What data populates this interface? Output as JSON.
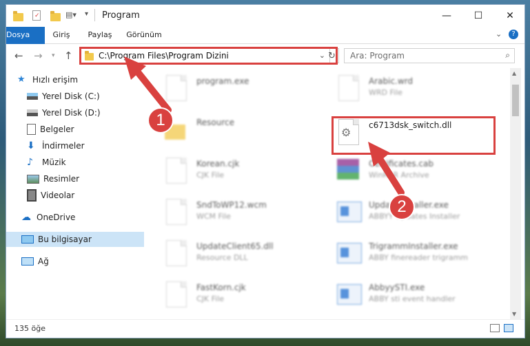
{
  "window": {
    "title": "Program"
  },
  "ribbon": {
    "tabs": [
      "Dosya",
      "Giriş",
      "Paylaş",
      "Görünüm"
    ]
  },
  "address": {
    "path": "C:\\Program Files\\Program Dizini"
  },
  "search": {
    "placeholder": "Ara: Program"
  },
  "sidebar": {
    "items": [
      {
        "label": "Hızlı erişim",
        "icon": "star-icon"
      },
      {
        "label": "Yerel Disk (C:)",
        "icon": "drive-icon",
        "pinned": true
      },
      {
        "label": "Yerel Disk (D:)",
        "icon": "drive-icon",
        "pinned": true
      },
      {
        "label": "Belgeler",
        "icon": "documents-icon",
        "pinned": true
      },
      {
        "label": "İndirmeler",
        "icon": "download-icon",
        "pinned": true
      },
      {
        "label": "Müzik",
        "icon": "music-icon",
        "pinned": true
      },
      {
        "label": "Resimler",
        "icon": "pictures-icon",
        "pinned": true
      },
      {
        "label": "Videolar",
        "icon": "video-icon",
        "pinned": true
      },
      {
        "label": "OneDrive",
        "icon": "cloud-icon"
      },
      {
        "label": "Bu bilgisayar",
        "icon": "computer-icon",
        "selected": true
      },
      {
        "label": "Ağ",
        "icon": "network-icon"
      }
    ]
  },
  "files": {
    "left": [
      {
        "name": "program.exe",
        "type": ""
      },
      {
        "name": "Resource",
        "type": ""
      },
      {
        "name": "Korean.cjk",
        "type": "CJK File"
      },
      {
        "name": "SndToWP12.wcm",
        "type": "WCM File"
      },
      {
        "name": "UpdateClient65.dll",
        "type": "Resource DLL"
      },
      {
        "name": "FastKorn.cjk",
        "type": "CJK File"
      }
    ],
    "right": [
      {
        "name": "Arabic.wrd",
        "type": "WRD File"
      },
      {
        "name": "c6713dsk_switch.dll",
        "type": ""
      },
      {
        "name": "Certificates.cab",
        "type": "WinRAR Archive"
      },
      {
        "name": "UpdateInstaller.exe",
        "type": "ABBYY Updates Installer"
      },
      {
        "name": "TrigrammInstaller.exe",
        "type": "ABBY finereader trigramm"
      },
      {
        "name": "AbbyySTI.exe",
        "type": "ABBY sti event handler"
      }
    ]
  },
  "status": {
    "count": "135 öğe"
  },
  "callouts": [
    "1",
    "2"
  ],
  "colors": {
    "accent": "#1a6fc4",
    "highlight": "#d9413f",
    "selection": "#cce4f7"
  }
}
